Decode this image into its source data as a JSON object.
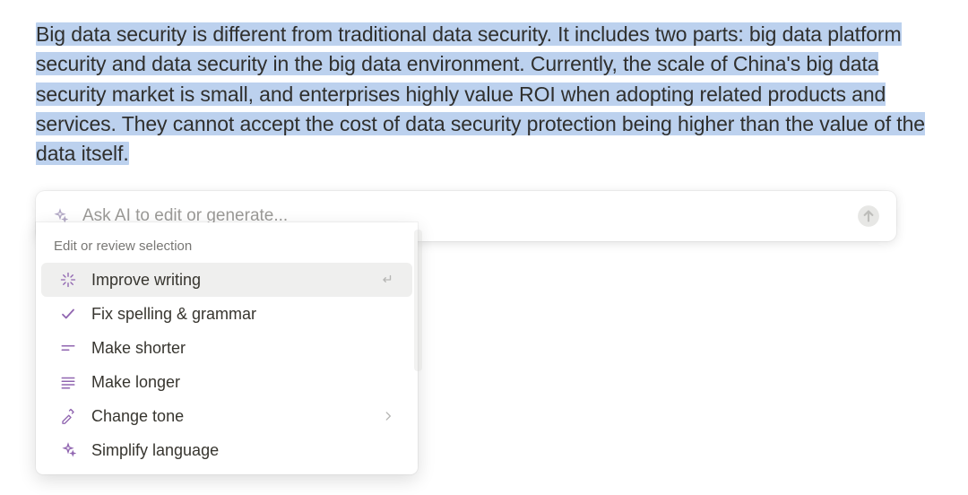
{
  "selection": {
    "text": "Big data security is different from traditional data security. It includes two parts: big data platform security and data security in the big data environment. Currently, the scale of China's big data security market is small, and enterprises highly value ROI when adopting related products and services. They cannot accept the cost of data security protection being higher than the value of the data itself."
  },
  "ai_bar": {
    "placeholder": "Ask AI to edit or generate...",
    "value": ""
  },
  "dropdown": {
    "section_title": "Edit or review selection",
    "items": [
      {
        "id": "improve-writing",
        "label": "Improve writing",
        "icon": "sparkle-burst",
        "tail": "enter",
        "active": true
      },
      {
        "id": "fix-spelling",
        "label": "Fix spelling & grammar",
        "icon": "check",
        "tail": null,
        "active": false
      },
      {
        "id": "make-shorter",
        "label": "Make shorter",
        "icon": "lines-short",
        "tail": null,
        "active": false
      },
      {
        "id": "make-longer",
        "label": "Make longer",
        "icon": "lines-long",
        "tail": null,
        "active": false
      },
      {
        "id": "change-tone",
        "label": "Change tone",
        "icon": "mic-pen",
        "tail": "chevron",
        "active": false
      },
      {
        "id": "simplify",
        "label": "Simplify language",
        "icon": "sparkle",
        "tail": null,
        "active": false
      }
    ]
  },
  "colors": {
    "highlight": "#bcd1ee",
    "purple": "#9065b0"
  }
}
